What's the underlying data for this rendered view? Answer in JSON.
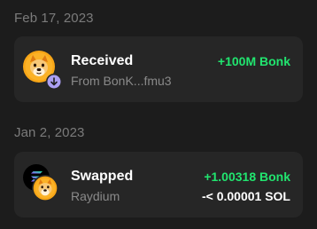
{
  "activity": {
    "groups": [
      {
        "date": "Feb 17, 2023",
        "transaction": {
          "type": "Received",
          "detail": "From BonK...fmu3",
          "amount_primary": "+100M Bonk",
          "token_icon": "bonk-token-icon",
          "badge_icon": "arrow-down-icon"
        }
      },
      {
        "date": "Jan 2, 2023",
        "transaction": {
          "type": "Swapped",
          "detail": "Raydium",
          "amount_primary": "+1.00318 Bonk",
          "amount_secondary": "-< 0.00001 SOL",
          "token_icon": "bonk-token-icon",
          "secondary_icon": "solana-icon"
        }
      }
    ]
  },
  "colors": {
    "background": "#1c1c1c",
    "card": "#262626",
    "positive": "#21e56f",
    "badge": "#ab9ff2",
    "muted_text": "#7b7b7b"
  }
}
